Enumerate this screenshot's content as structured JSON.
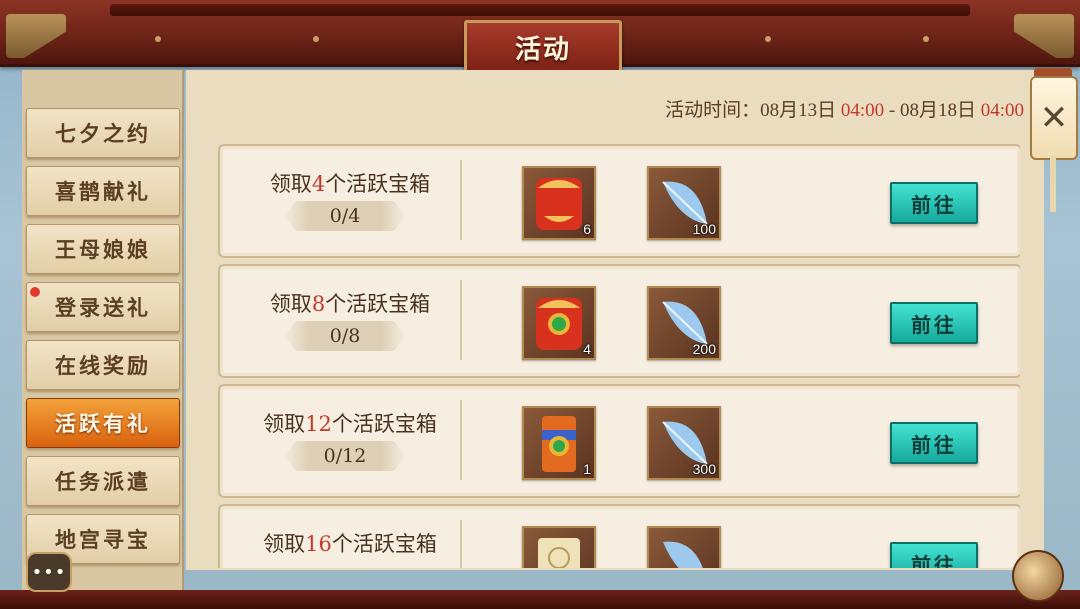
{
  "header": {
    "title": "活动"
  },
  "sidebar": {
    "items": [
      {
        "label": "七夕之约",
        "active": false,
        "badge": false
      },
      {
        "label": "喜鹊献礼",
        "active": false,
        "badge": false
      },
      {
        "label": "王母娘娘",
        "active": false,
        "badge": false
      },
      {
        "label": "登录送礼",
        "active": false,
        "badge": true
      },
      {
        "label": "在线奖励",
        "active": false,
        "badge": false
      },
      {
        "label": "活跃有礼",
        "active": true,
        "badge": false
      },
      {
        "label": "任务派遣",
        "active": false,
        "badge": false
      },
      {
        "label": "地宫寻宝",
        "active": false,
        "badge": false
      }
    ]
  },
  "event_time": {
    "prefix": "活动时间：",
    "start_date": "08月13日",
    "start_time": "04:00",
    "separator": " - ",
    "end_date": "08月18日",
    "end_time": "04:00"
  },
  "tasks": [
    {
      "pre": "领取",
      "num": "4",
      "post": "个活跃宝箱",
      "progress": "0/4",
      "rewards": [
        {
          "icon": "red-pouch-icon",
          "qty": "6"
        },
        {
          "icon": "blue-feather-icon",
          "qty": "100"
        }
      ],
      "button": "前往"
    },
    {
      "pre": "领取",
      "num": "8",
      "post": "个活跃宝箱",
      "progress": "0/8",
      "rewards": [
        {
          "icon": "jade-pouch-icon",
          "qty": "4"
        },
        {
          "icon": "blue-feather-icon",
          "qty": "200"
        }
      ],
      "button": "前往"
    },
    {
      "pre": "领取",
      "num": "12",
      "post": "个活跃宝箱",
      "progress": "0/12",
      "rewards": [
        {
          "icon": "jeweled-scroll-icon",
          "qty": "1"
        },
        {
          "icon": "blue-feather-icon",
          "qty": "300"
        }
      ],
      "button": "前往"
    },
    {
      "pre": "领取",
      "num": "16",
      "post": "个活跃宝箱",
      "progress": "",
      "rewards": [
        {
          "icon": "paper-scroll-icon",
          "qty": ""
        },
        {
          "icon": "blue-feather-icon",
          "qty": ""
        }
      ],
      "button": "前往"
    }
  ],
  "bottom": {
    "chat_label": "•••"
  },
  "colors": {
    "accent_red": "#c43a2a",
    "go_button": "#2cc7b7",
    "active_tab": "#e8801f"
  }
}
